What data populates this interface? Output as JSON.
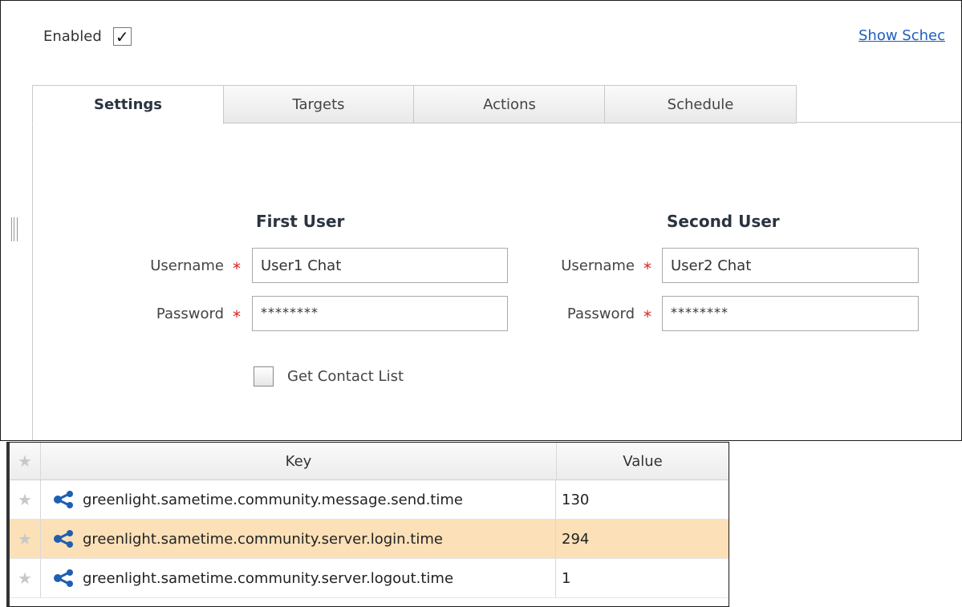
{
  "enabled": {
    "label": "Enabled",
    "checked": true,
    "check_glyph": "✓"
  },
  "show_schedule_link": "Show Schec",
  "tabs": [
    {
      "label": "Settings",
      "active": true
    },
    {
      "label": "Targets",
      "active": false
    },
    {
      "label": "Actions",
      "active": false
    },
    {
      "label": "Schedule",
      "active": false
    }
  ],
  "settings": {
    "first_user": {
      "title": "First User",
      "username_label": "Username",
      "username_value": "User1 Chat",
      "password_label": "Password",
      "password_value": "********"
    },
    "second_user": {
      "title": "Second User",
      "username_label": "Username",
      "username_value": "User2 Chat",
      "password_label": "Password",
      "password_value": "********"
    },
    "required_marker": "*",
    "contact_list": {
      "label": "Get Contact List",
      "checked": false
    }
  },
  "metrics_table": {
    "columns": {
      "key": "Key",
      "value": "Value"
    },
    "rows": [
      {
        "key": "greenlight.sametime.community.message.send.time",
        "value": "130",
        "highlighted": false
      },
      {
        "key": "greenlight.sametime.community.server.login.time",
        "value": "294",
        "highlighted": true
      },
      {
        "key": "greenlight.sametime.community.server.logout.time",
        "value": "1",
        "highlighted": false
      }
    ],
    "icons": {
      "star": "star-icon",
      "metric": "share-icon"
    }
  },
  "colors": {
    "link": "#1c5fbf",
    "required": "#dd2222",
    "highlight_row": "#fbe0b8",
    "metric_icon": "#1f5fb0"
  }
}
